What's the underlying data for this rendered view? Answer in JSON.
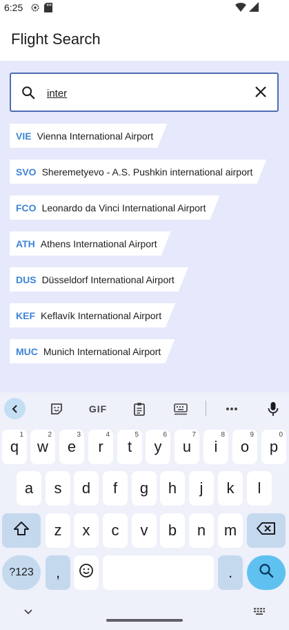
{
  "status_bar": {
    "time": "6:25"
  },
  "app_bar": {
    "title": "Flight Search"
  },
  "search": {
    "value": "inter"
  },
  "results": [
    {
      "code": "VIE",
      "name": "Vienna International Airport"
    },
    {
      "code": "SVO",
      "name": "Sheremetyevo - A.S. Pushkin international airport"
    },
    {
      "code": "FCO",
      "name": "Leonardo da Vinci International Airport"
    },
    {
      "code": "ATH",
      "name": "Athens International Airport"
    },
    {
      "code": "DUS",
      "name": "Düsseldorf International Airport"
    },
    {
      "code": "KEF",
      "name": "Keflavík International Airport"
    },
    {
      "code": "MUC",
      "name": "Munich International Airport"
    }
  ],
  "keyboard": {
    "toolbar": {
      "gif_label": "GIF"
    },
    "row1": [
      {
        "key": "q",
        "hint": "1"
      },
      {
        "key": "w",
        "hint": "2"
      },
      {
        "key": "e",
        "hint": "3"
      },
      {
        "key": "r",
        "hint": "4"
      },
      {
        "key": "t",
        "hint": "5"
      },
      {
        "key": "y",
        "hint": "6"
      },
      {
        "key": "u",
        "hint": "7"
      },
      {
        "key": "i",
        "hint": "8"
      },
      {
        "key": "o",
        "hint": "9"
      },
      {
        "key": "p",
        "hint": "0"
      }
    ],
    "row2": [
      "a",
      "s",
      "d",
      "f",
      "g",
      "h",
      "j",
      "k",
      "l"
    ],
    "row3": [
      "z",
      "x",
      "c",
      "v",
      "b",
      "n",
      "m"
    ],
    "symbols_label": "?123",
    "comma": ",",
    "period": "."
  },
  "colors": {
    "accent": "#3d84d6",
    "content_bg": "#e6e9fb",
    "search_border": "#4f6bb5",
    "action_key": "#5fc1f0"
  }
}
